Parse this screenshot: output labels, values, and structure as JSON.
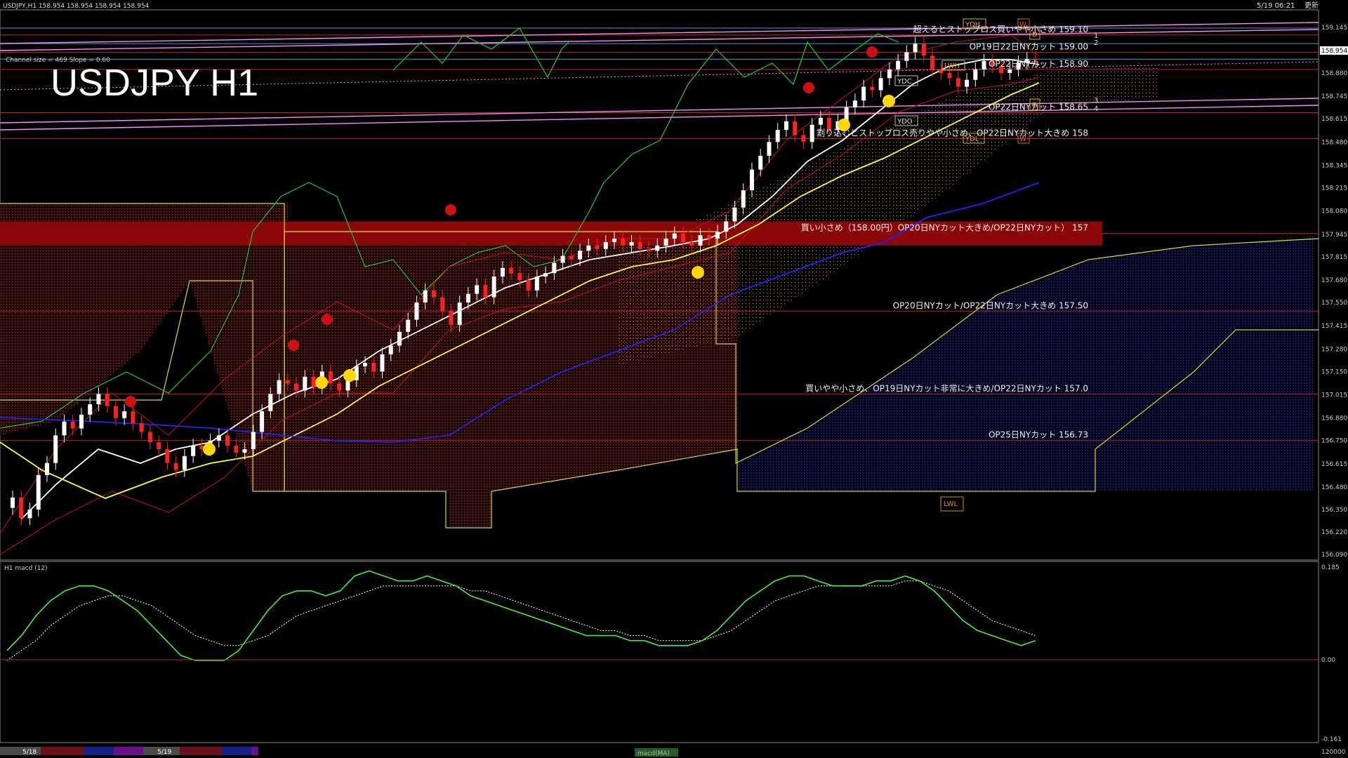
{
  "header": {
    "symbol_line": "USDJPY,H1  158.954 158.954 158.954 158.954",
    "datetime": "5/19 06:21",
    "update_label": "更新",
    "channel_info": "Channel size = 469 Slope = 0.60",
    "big_title": "USDJPY H1"
  },
  "price_panel": {
    "ylim": [
      156.09,
      159.14
    ],
    "ticks": [
      "159.145",
      "159.010",
      "158.880",
      "158.745",
      "158.615",
      "158.480",
      "158.345",
      "158.215",
      "158.080",
      "157.945",
      "157.815",
      "157.680",
      "157.550",
      "157.415",
      "157.280",
      "157.150",
      "157.015",
      "156.880",
      "156.750",
      "156.615",
      "156.480",
      "156.350",
      "156.220",
      "156.090"
    ],
    "current_price": "158.954",
    "level_labels": [
      {
        "text": "超えるとストップロス買いやや小さめ 159.10",
        "price": 159.1
      },
      {
        "text": "OP19日22日NYカット 159.00",
        "price": 159.0
      },
      {
        "text": "OP22日NYカット 158.90",
        "price": 158.9
      },
      {
        "text": "OP22日NYカット 158.65",
        "price": 158.65
      },
      {
        "text": "割り込むとストップロス売りやや小さめ、OP22日NYカット大きめ 158",
        "price": 158.5
      },
      {
        "text": "買い小さめ（158.00円）OP20日NYカット大きめ/OP22日NYカット） 157",
        "price": 157.95
      },
      {
        "text": "OP20日NYカット/OP22日NYカット大きめ 157.50",
        "price": 157.5
      },
      {
        "text": "買いやや小さめ、OP19日NYカット非常に大きめ/OP22日NYカット 157.0",
        "price": 157.02
      },
      {
        "text": "OP25日NYカット 156.73",
        "price": 156.75
      }
    ],
    "box_labels": [
      "YDH",
      "YDC",
      "YDO",
      "YDL",
      "LWH",
      "LWL",
      "D",
      "D",
      "W",
      "W"
    ],
    "channel_numbers": [
      "1",
      "2",
      "3",
      "4"
    ]
  },
  "macd_panel": {
    "label": "H1  macd (12)",
    "ticks": [
      "0.185",
      "0.00",
      "-0.161"
    ],
    "volume_tick": "120000"
  },
  "bottom_bar": {
    "dates": [
      "5/18",
      "5/19"
    ],
    "tag": "macd(MA)"
  },
  "colors": {
    "background": "#000000",
    "bull": "#ffffff",
    "bear": "#ff2020",
    "ma_fast": "#ffffff",
    "ma_mid": "#ffff33",
    "ma_slow": "#2222ff",
    "chikou": "#22cc22",
    "level": "#cc2222",
    "channel": "#ff88ff",
    "ichimoku_span": "#dddd22",
    "macd": "#44ee44",
    "signal": "#ffffff"
  },
  "chart_data": {
    "type": "candlestick",
    "title": "USDJPY H1",
    "timeframe": "H1",
    "dates": [
      "5/18",
      "5/19"
    ],
    "ylim": [
      156.09,
      159.14
    ],
    "close": [
      156.42,
      156.3,
      156.35,
      156.55,
      156.62,
      156.78,
      156.86,
      156.82,
      156.9,
      156.96,
      157.02,
      156.95,
      156.88,
      156.92,
      156.85,
      156.8,
      156.74,
      156.7,
      156.62,
      156.58,
      156.66,
      156.72,
      156.7,
      156.75,
      156.78,
      156.72,
      156.68,
      156.7,
      156.8,
      156.92,
      157.02,
      157.1,
      157.08,
      157.04,
      157.12,
      157.06,
      157.15,
      157.08,
      157.04,
      157.1,
      157.18,
      157.2,
      157.15,
      157.25,
      157.3,
      157.38,
      157.45,
      157.55,
      157.62,
      157.58,
      157.5,
      157.42,
      157.55,
      157.6,
      157.65,
      157.58,
      157.7,
      157.75,
      157.72,
      157.68,
      157.62,
      157.7,
      157.72,
      157.78,
      157.82,
      157.8,
      157.85,
      157.88,
      157.86,
      157.9,
      157.92,
      157.88,
      157.9,
      157.86,
      157.85,
      157.88,
      157.92,
      157.95,
      157.9,
      157.88,
      157.94,
      157.92,
      157.96,
      158.02,
      158.1,
      158.2,
      158.32,
      158.4,
      158.48,
      158.55,
      158.6,
      158.52,
      158.48,
      158.58,
      158.62,
      158.55,
      158.6,
      158.68,
      158.72,
      158.8,
      158.78,
      158.85,
      158.9,
      158.95,
      159.0,
      159.05,
      158.98,
      158.9,
      158.88,
      158.85,
      158.8,
      158.84,
      158.9,
      158.95,
      158.92,
      158.88,
      158.9,
      158.94,
      158.96,
      158.954
    ],
    "open": [
      156.36,
      156.42,
      156.3,
      156.35,
      156.55,
      156.62,
      156.78,
      156.86,
      156.82,
      156.9,
      156.96,
      157.02,
      156.95,
      156.88,
      156.92,
      156.85,
      156.8,
      156.74,
      156.7,
      156.62,
      156.58,
      156.66,
      156.72,
      156.7,
      156.75,
      156.78,
      156.72,
      156.68,
      156.7,
      156.8,
      156.92,
      157.02,
      157.1,
      157.08,
      157.04,
      157.12,
      157.06,
      157.15,
      157.08,
      157.04,
      157.1,
      157.18,
      157.2,
      157.15,
      157.25,
      157.3,
      157.38,
      157.45,
      157.55,
      157.62,
      157.58,
      157.5,
      157.42,
      157.55,
      157.6,
      157.65,
      157.58,
      157.7,
      157.75,
      157.72,
      157.68,
      157.62,
      157.7,
      157.72,
      157.78,
      157.82,
      157.8,
      157.85,
      157.88,
      157.86,
      157.9,
      157.92,
      157.88,
      157.9,
      157.86,
      157.85,
      157.88,
      157.92,
      157.95,
      157.9,
      157.88,
      157.94,
      157.92,
      157.96,
      158.02,
      158.1,
      158.2,
      158.32,
      158.4,
      158.48,
      158.55,
      158.6,
      158.52,
      158.48,
      158.58,
      158.62,
      158.55,
      158.6,
      158.68,
      158.72,
      158.8,
      158.78,
      158.85,
      158.9,
      158.95,
      159.0,
      159.05,
      158.98,
      158.9,
      158.88,
      158.85,
      158.8,
      158.84,
      158.9,
      158.95,
      158.92,
      158.88,
      158.9,
      158.94,
      158.96
    ],
    "macd": [
      0.02,
      0.05,
      0.09,
      0.12,
      0.14,
      0.15,
      0.15,
      0.14,
      0.12,
      0.1,
      0.07,
      0.04,
      0.01,
      0.0,
      0.0,
      0.0,
      0.02,
      0.06,
      0.1,
      0.13,
      0.14,
      0.14,
      0.13,
      0.14,
      0.17,
      0.18,
      0.17,
      0.16,
      0.16,
      0.17,
      0.16,
      0.15,
      0.13,
      0.12,
      0.11,
      0.1,
      0.09,
      0.08,
      0.07,
      0.06,
      0.05,
      0.05,
      0.05,
      0.04,
      0.04,
      0.03,
      0.03,
      0.03,
      0.04,
      0.06,
      0.09,
      0.12,
      0.14,
      0.16,
      0.17,
      0.17,
      0.16,
      0.15,
      0.15,
      0.15,
      0.16,
      0.16,
      0.17,
      0.16,
      0.14,
      0.11,
      0.08,
      0.06,
      0.05,
      0.04,
      0.03,
      0.04
    ],
    "signal": [
      0.0,
      0.02,
      0.04,
      0.07,
      0.09,
      0.11,
      0.12,
      0.13,
      0.13,
      0.12,
      0.11,
      0.09,
      0.07,
      0.05,
      0.04,
      0.03,
      0.03,
      0.04,
      0.05,
      0.07,
      0.09,
      0.1,
      0.11,
      0.12,
      0.13,
      0.14,
      0.15,
      0.15,
      0.15,
      0.15,
      0.15,
      0.15,
      0.14,
      0.14,
      0.13,
      0.12,
      0.11,
      0.1,
      0.09,
      0.08,
      0.07,
      0.06,
      0.06,
      0.05,
      0.05,
      0.04,
      0.04,
      0.04,
      0.04,
      0.05,
      0.06,
      0.08,
      0.1,
      0.12,
      0.13,
      0.14,
      0.15,
      0.15,
      0.15,
      0.15,
      0.15,
      0.15,
      0.16,
      0.16,
      0.15,
      0.14,
      0.12,
      0.1,
      0.08,
      0.07,
      0.06,
      0.05
    ],
    "macd_ylim": [
      -0.161,
      0.185
    ]
  }
}
